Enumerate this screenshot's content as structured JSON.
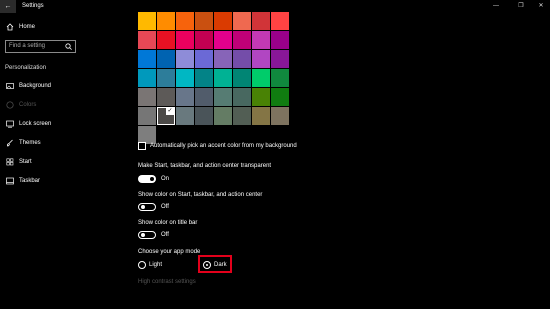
{
  "window": {
    "title": "Settings",
    "back_icon": "back-arrow-icon",
    "minimize": "—",
    "maximize": "❐",
    "close": "✕"
  },
  "sidebar": {
    "home_label": "Home",
    "search_placeholder": "Find a setting",
    "section_title": "Personalization",
    "items": [
      {
        "label": "Background",
        "icon": "picture-icon"
      },
      {
        "label": "Colors",
        "icon": "palette-icon",
        "active": true
      },
      {
        "label": "Lock screen",
        "icon": "lock-screen-icon"
      },
      {
        "label": "Themes",
        "icon": "brush-icon"
      },
      {
        "label": "Start",
        "icon": "start-icon"
      },
      {
        "label": "Taskbar",
        "icon": "taskbar-icon"
      }
    ]
  },
  "accent_colors": [
    [
      "#ffb900",
      "#ff8c00",
      "#f7630c",
      "#ca5010",
      "#da3b01",
      "#ef6950",
      "#d13438",
      "#ff4343"
    ],
    [
      "#e74856",
      "#e81123",
      "#ea005e",
      "#c30052",
      "#e3008c",
      "#bf0077",
      "#c239b3",
      "#9a0089"
    ],
    [
      "#0078d7",
      "#0063b1",
      "#8e8cd8",
      "#6b69d6",
      "#8764b8",
      "#744da9",
      "#b146c2",
      "#881798"
    ],
    [
      "#0099bc",
      "#2d7d9a",
      "#00b7c3",
      "#038387",
      "#00b294",
      "#018574",
      "#00cc6a",
      "#10893e"
    ],
    [
      "#7a7574",
      "#5d5a58",
      "#68768a",
      "#515c6b",
      "#567c73",
      "#486860",
      "#498205",
      "#107c10"
    ],
    [
      "#767676",
      "#4c4a48",
      "#69797e",
      "#4a5459",
      "#647c64",
      "#525e54",
      "#847545",
      "#7e735f"
    ],
    [
      "#7e7e7e"
    ]
  ],
  "selected_swatch": {
    "row": 5,
    "col": 1
  },
  "auto_accent_label": "Automatically pick an accent color from my background",
  "settings": {
    "transparent": {
      "label": "Make Start, taskbar, and action center transparent",
      "state": "On"
    },
    "color_start": {
      "label": "Show color on Start, taskbar, and action center",
      "state": "Off"
    },
    "color_titlebar": {
      "label": "Show color on title bar",
      "state": "Off"
    }
  },
  "app_mode": {
    "label": "Choose your app mode",
    "options": [
      "Light",
      "Dark"
    ],
    "selected": "Dark"
  },
  "high_contrast_link": "High contrast settings",
  "colors": {
    "highlight": "#e3001b"
  }
}
